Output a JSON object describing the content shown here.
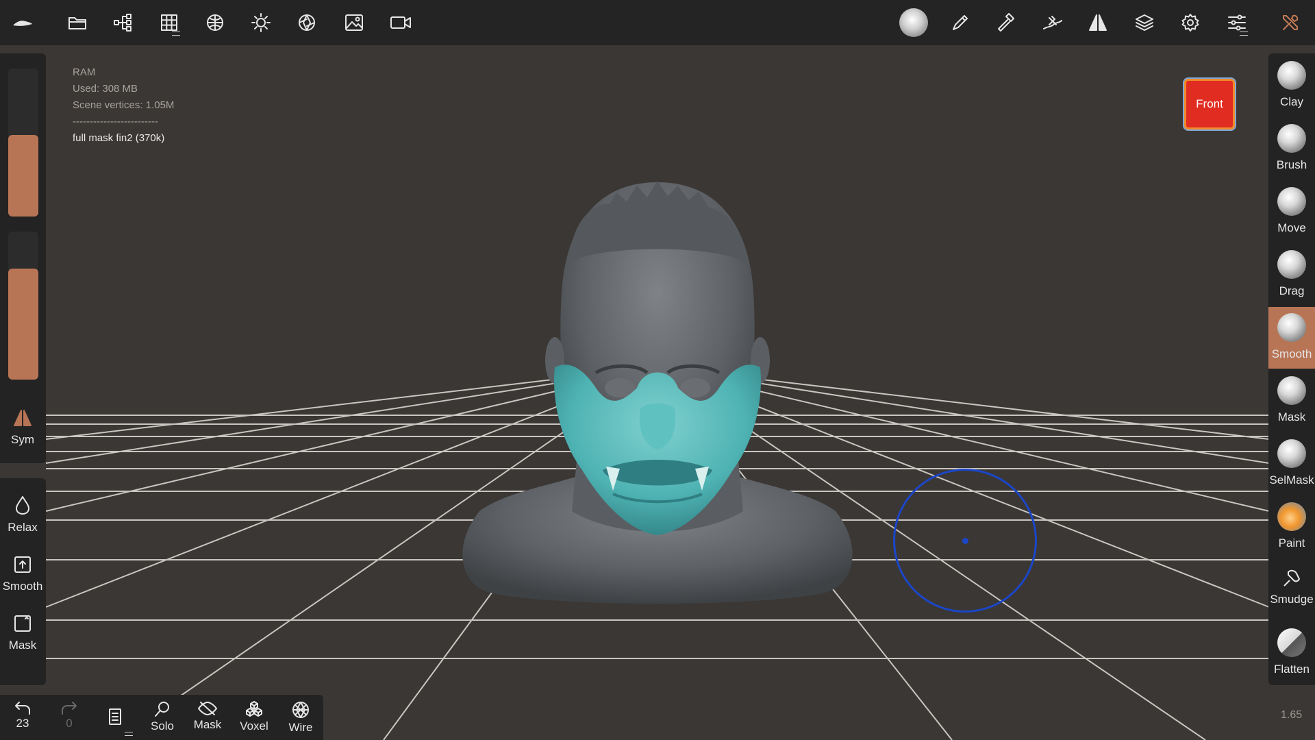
{
  "topbar": {
    "left_tools": [
      {
        "name": "nomad-logo-icon"
      },
      {
        "name": "folder-icon"
      },
      {
        "name": "scene-tree-icon"
      },
      {
        "name": "topology-grid-icon"
      },
      {
        "name": "material-icon"
      },
      {
        "name": "light-icon"
      },
      {
        "name": "postprocess-aperture-icon"
      },
      {
        "name": "background-image-icon"
      },
      {
        "name": "camera-icon"
      }
    ],
    "right_tools": [
      {
        "name": "current-brush-sphere-icon"
      },
      {
        "name": "paint-stroke-icon"
      },
      {
        "name": "hammer-icon"
      },
      {
        "name": "stroke-settings-icon"
      },
      {
        "name": "symmetry-icon"
      },
      {
        "name": "layers-icon"
      },
      {
        "name": "settings-gear-icon"
      },
      {
        "name": "sliders-icon"
      },
      {
        "name": "tools-wrench-icon"
      }
    ]
  },
  "info": {
    "ram": "RAM",
    "used": "Used: 308 MB",
    "vertices": "Scene vertices: 1.05M",
    "divider": "-------------------------",
    "object": "full mask fin2 (370k)"
  },
  "left_panel": {
    "radius_level": 0.55,
    "intensity_level": 0.75,
    "sym_label": "Sym",
    "relax_label": "Relax",
    "smooth_label": "Smooth",
    "mask_label": "Mask"
  },
  "right_panel": {
    "brushes": [
      {
        "label": "Clay",
        "active": false
      },
      {
        "label": "Brush",
        "active": false
      },
      {
        "label": "Move",
        "active": false
      },
      {
        "label": "Drag",
        "active": false
      },
      {
        "label": "Smooth",
        "active": true
      },
      {
        "label": "Mask",
        "active": false
      },
      {
        "label": "SelMask",
        "active": false
      },
      {
        "label": "Paint",
        "active": false
      },
      {
        "label": "Smudge",
        "active": false
      },
      {
        "label": "Flatten",
        "active": false
      }
    ]
  },
  "view_cube": {
    "label": "Front"
  },
  "bottombar": {
    "undo_count": "23",
    "redo_count": "0",
    "solo_label": "Solo",
    "mask_label": "Mask",
    "voxel_label": "Voxel",
    "wire_label": "Wire"
  },
  "zoom": "1.65",
  "colors": {
    "accent": "#b87556",
    "mask_teal": "#4fb3b3",
    "brush_cursor": "#1b46c8",
    "view_cube": "#e12c22"
  }
}
